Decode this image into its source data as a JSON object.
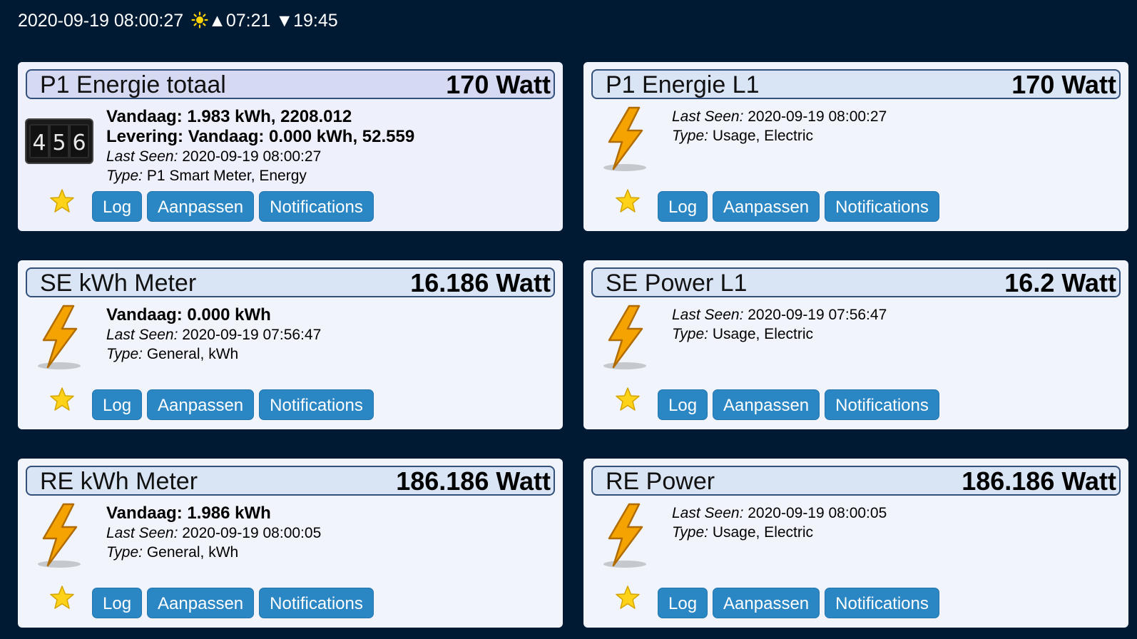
{
  "header": {
    "datetime": "2020-09-19 08:00:27",
    "sun_icon": "sun-icon",
    "sunrise_icon": "▲",
    "sunrise": "07:21",
    "sunset_icon": "▼",
    "sunset": "19:45"
  },
  "buttons": {
    "log": "Log",
    "edit": "Aanpassen",
    "notifications": "Notifications"
  },
  "labels": {
    "last_seen": "Last Seen:",
    "type": "Type:"
  },
  "cards": [
    {
      "title": "P1 Energie totaal",
      "value": "170 Watt",
      "icon": "counter-meter-icon",
      "meter_digits": [
        "4",
        "5",
        "6"
      ],
      "lines": [
        "Vandaag: 1.983 kWh, 2208.012",
        "Levering: Vandaag: 0.000 kWh, 52.559"
      ],
      "last_seen": "2020-09-19 08:00:27",
      "type": "P1 Smart Meter, Energy"
    },
    {
      "title": "P1 Energie L1",
      "value": "170 Watt",
      "icon": "lightning-icon",
      "last_seen": "2020-09-19 08:00:27",
      "type": "Usage, Electric"
    },
    {
      "title": "SE kWh Meter",
      "value": "16.186 Watt",
      "icon": "lightning-icon",
      "lines": [
        "Vandaag: 0.000 kWh"
      ],
      "last_seen": "2020-09-19 07:56:47",
      "type": "General, kWh"
    },
    {
      "title": "SE Power L1",
      "value": "16.2 Watt",
      "icon": "lightning-icon",
      "last_seen": "2020-09-19 07:56:47",
      "type": "Usage, Electric"
    },
    {
      "title": "RE kWh Meter",
      "value": "186.186 Watt",
      "icon": "lightning-icon",
      "lines": [
        "Vandaag: 1.986 kWh"
      ],
      "last_seen": "2020-09-19 08:00:05",
      "type": "General, kWh"
    },
    {
      "title": "RE Power",
      "value": "186.186 Watt",
      "icon": "lightning-icon",
      "last_seen": "2020-09-19 08:00:05",
      "type": "Usage, Electric"
    }
  ],
  "colors": {
    "background": "#001a33",
    "card": "#f1f4fb",
    "header_border": "#33507a",
    "button": "#2b86c4",
    "star": "#ffd21a",
    "lightning": "#f5a300"
  }
}
